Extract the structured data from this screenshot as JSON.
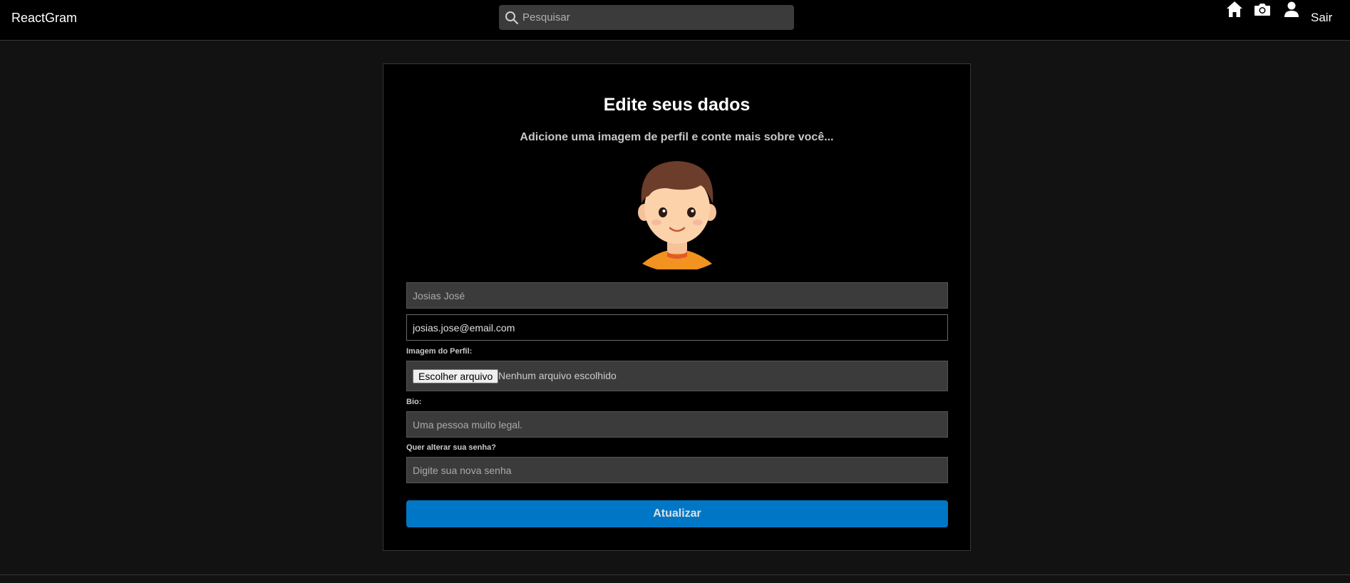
{
  "navbar": {
    "brand": "ReactGram",
    "search_placeholder": "Pesquisar",
    "icons": [
      "home-icon",
      "camera-icon",
      "user-icon"
    ],
    "logout_label": "Sair"
  },
  "form": {
    "title": "Edite seus dados",
    "subtitle": "Adicione uma imagem de perfil e conte mais sobre você...",
    "name_value": "Josias José",
    "email_value": "josias.jose@email.com",
    "image_label": "Imagem do Perfil:",
    "file_button_label": "Escolher arquivo",
    "file_status": "Nenhum arquivo escolhido",
    "bio_label": "Bio:",
    "bio_value": "Uma pessoa muito legal.",
    "password_label": "Quer alterar sua senha?",
    "password_placeholder": "Digite sua nova senha",
    "submit_label": "Atualizar"
  },
  "colors": {
    "background": "#121212",
    "navbar": "#000000",
    "input": "#3b3b3b",
    "accent": "#0077c6"
  }
}
